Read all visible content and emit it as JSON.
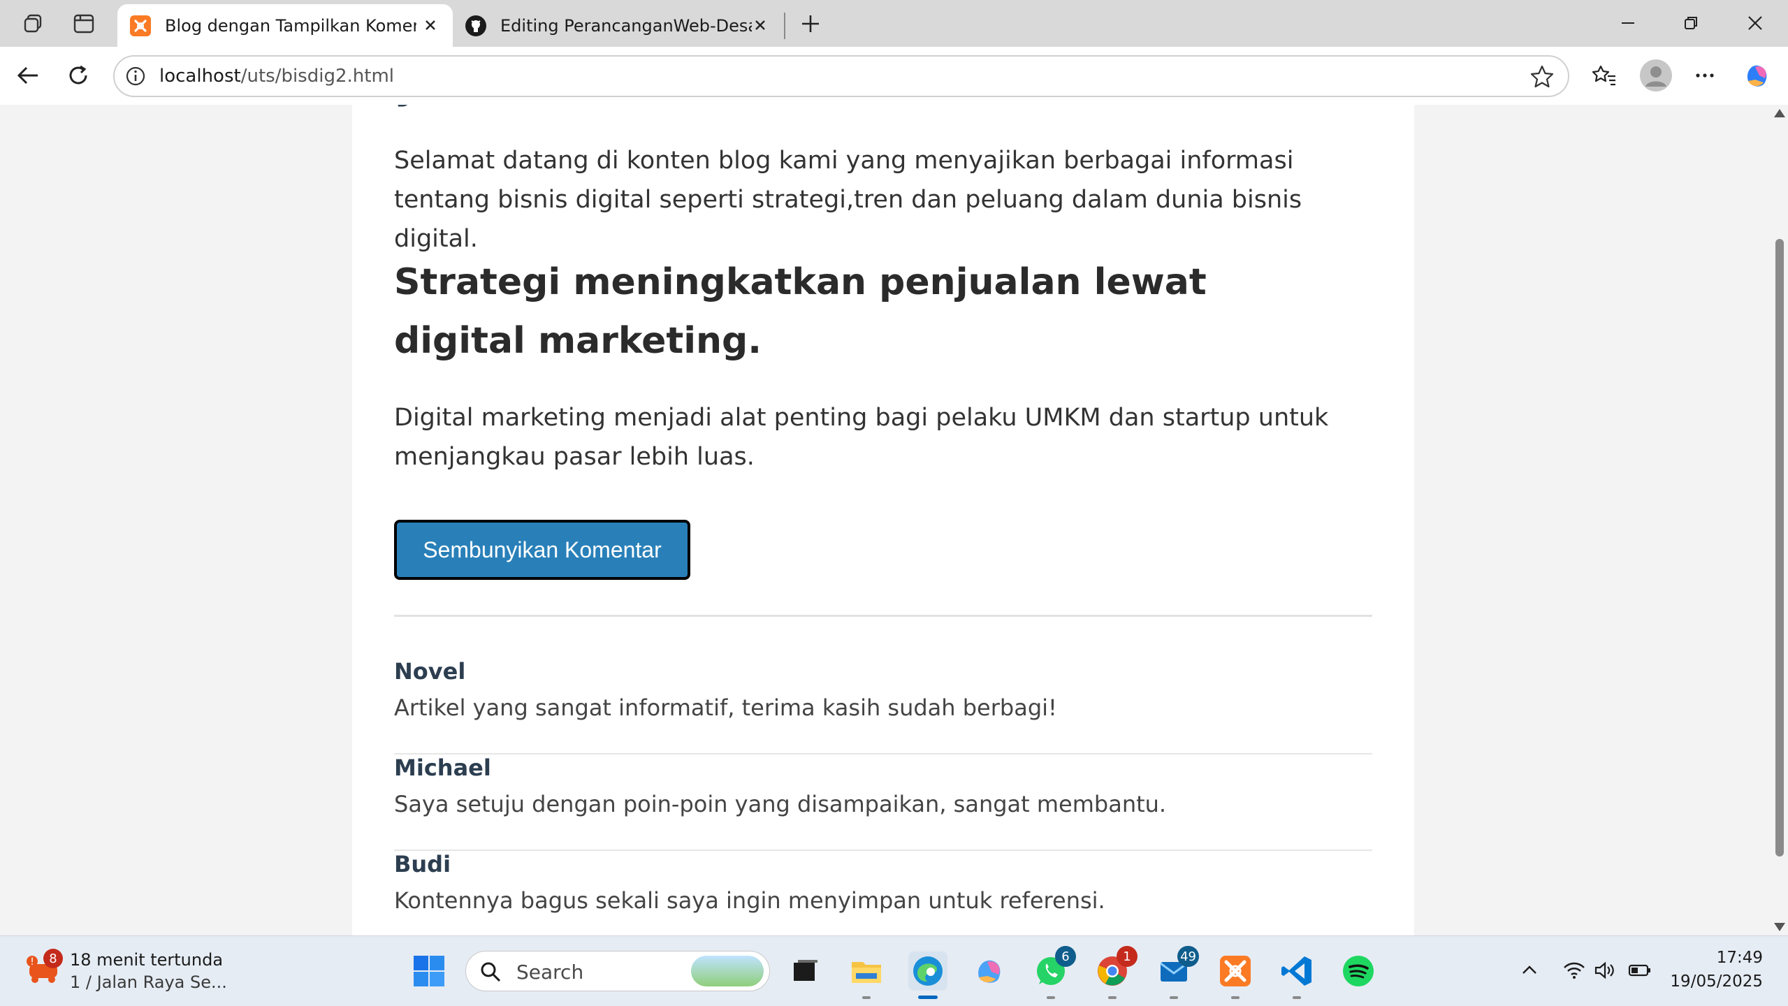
{
  "browser": {
    "tabs": [
      {
        "title": "Blog dengan Tampilkan Komentar",
        "active": true
      },
      {
        "title": "Editing PerancanganWeb-DesainG",
        "active": false
      }
    ],
    "url": {
      "host": "localhost",
      "path": "/uts/bisdig2.html"
    }
  },
  "page": {
    "partial_title": "y",
    "intro": "Selamat datang di konten blog kami yang menyajikan berbagai informasi tentang bisnis digital seperti strategi,tren dan peluang dalam dunia bisnis digital.",
    "heading": "Strategi meningkatkan penjualan lewat digital marketing.",
    "paragraph": "Digital marketing menjadi alat penting bagi pelaku UMKM dan startup untuk menjangkau pasar lebih luas.",
    "toggle_button": "Sembunyikan Komentar",
    "comments": [
      {
        "author": "Novel",
        "text": "Artikel yang sangat informatif, terima kasih sudah berbagi!"
      },
      {
        "author": "Michael",
        "text": "Saya setuju dengan poin-poin yang disampaikan, sangat membantu."
      },
      {
        "author": "Budi",
        "text": "Kontennya bagus sekali saya ingin menyimpan untuk referensi."
      }
    ],
    "accent_color": "#2980b9"
  },
  "taskbar": {
    "weather": {
      "badge": "8",
      "line1": "18 menit tertunda",
      "line2": "1 / Jalan Raya Se..."
    },
    "search_placeholder": "Search",
    "badges": {
      "whatsapp": "6",
      "chrome": "1",
      "mail": "49"
    },
    "clock": {
      "time": "17:49",
      "date": "19/05/2025"
    }
  }
}
